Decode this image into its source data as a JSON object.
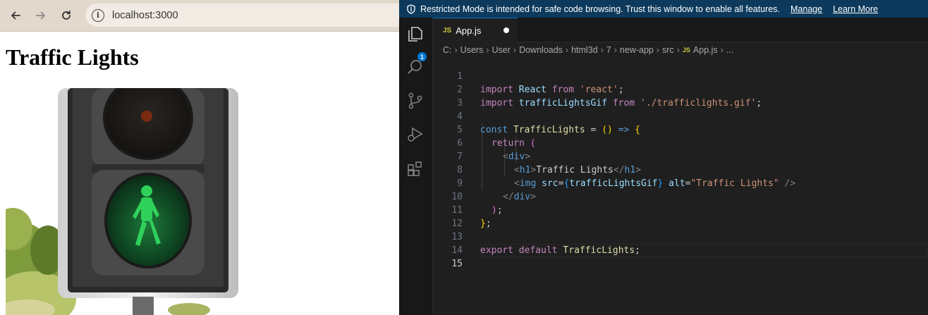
{
  "browser": {
    "url": "localhost:3000",
    "heading": "Traffic Lights",
    "image_alt": "Traffic Lights"
  },
  "vscode": {
    "banner": {
      "message": "Restricted Mode is intended for safe code browsing. Trust this window to enable all features.",
      "manage": "Manage",
      "learn_more": "Learn More"
    },
    "explorer_badge": "1",
    "tab": {
      "js_icon": "JS",
      "label": "App.js"
    },
    "breadcrumb": {
      "parts": [
        "C:",
        "Users",
        "User",
        "Downloads",
        "html3d",
        "7",
        "new-app",
        "src"
      ],
      "file_icon": "JS",
      "file": "App.js",
      "ellipsis": "..."
    },
    "line_numbers": [
      "1",
      "2",
      "3",
      "4",
      "5",
      "6",
      "7",
      "8",
      "9",
      "10",
      "11",
      "12",
      "13",
      "14",
      "15"
    ],
    "code": {
      "l1": [
        "import",
        " ",
        "React",
        " ",
        "from",
        " ",
        "'react'",
        ";"
      ],
      "l2": [
        "import",
        " ",
        "trafficLightsGif",
        " ",
        "from",
        " ",
        "'./trafficlights.gif'",
        ";"
      ],
      "l4": [
        "const",
        " ",
        "TrafficLights",
        " = ",
        "()",
        " ",
        "=>",
        " ",
        "{"
      ],
      "l5": [
        "return",
        " ",
        "("
      ],
      "l6": [
        "<",
        "div",
        ">"
      ],
      "l7": [
        "<",
        "h1",
        ">",
        "Traffic Lights",
        "</",
        "h1",
        ">"
      ],
      "l8": [
        "<",
        "img",
        " ",
        "src",
        "=",
        "{",
        "trafficLightsGif",
        "}",
        " ",
        "alt",
        "=",
        "\"Traffic Lights\"",
        " ",
        "/>"
      ],
      "l9": [
        "</",
        "div",
        ">"
      ],
      "l10": [
        ")",
        ";"
      ],
      "l11": [
        "}",
        ";"
      ],
      "l13": [
        "export",
        " ",
        "default",
        " ",
        "TrafficLights",
        ";"
      ]
    }
  }
}
